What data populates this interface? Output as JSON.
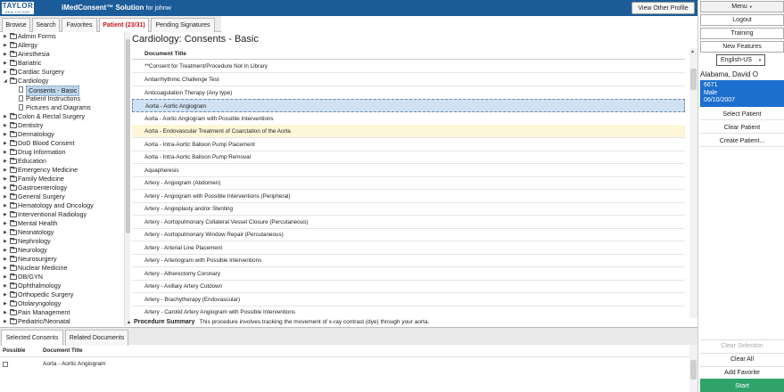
{
  "header": {
    "logo_line1": "TAYLOR",
    "logo_line2": "HEALTHCARE",
    "app_title": "iMedConsent™ Solution",
    "for_user": "for johnw",
    "view_other_profile": "View Other Profile"
  },
  "tabs": [
    {
      "label": "Browse"
    },
    {
      "label": "Search"
    },
    {
      "label": "Favorites"
    },
    {
      "label": "Patient (23/31)"
    },
    {
      "label": "Pending Signatures"
    }
  ],
  "tree": {
    "items": [
      {
        "label": "Admin Forms"
      },
      {
        "label": "Allergy"
      },
      {
        "label": "Anesthesia"
      },
      {
        "label": "Bariatric"
      },
      {
        "label": "Cardiac Surgery"
      },
      {
        "label": "Cardiology"
      },
      {
        "label": "Consents - Basic"
      },
      {
        "label": "Patient Instructions"
      },
      {
        "label": "Pictures and Diagrams"
      },
      {
        "label": "Colon & Rectal Surgery"
      },
      {
        "label": "Dentistry"
      },
      {
        "label": "Dermatology"
      },
      {
        "label": "DoD Blood Consent"
      },
      {
        "label": "Drug Information"
      },
      {
        "label": "Education"
      },
      {
        "label": "Emergency Medicine"
      },
      {
        "label": "Family Medicine"
      },
      {
        "label": "Gastroenterology"
      },
      {
        "label": "General Surgery"
      },
      {
        "label": "Hematology and Oncology"
      },
      {
        "label": "Interventional Radiology"
      },
      {
        "label": "Mental Health"
      },
      {
        "label": "Neonatology"
      },
      {
        "label": "Nephrology"
      },
      {
        "label": "Neurology"
      },
      {
        "label": "Neurosurgery"
      },
      {
        "label": "Nuclear Medicine"
      },
      {
        "label": "OB/GYN"
      },
      {
        "label": "Ophthalmology"
      },
      {
        "label": "Orthopedic Surgery"
      },
      {
        "label": "Otolaryngology"
      },
      {
        "label": "Pain Management"
      },
      {
        "label": "Pediatric/Neonatal"
      }
    ]
  },
  "main": {
    "title": "Cardiology: Consents - Basic",
    "column_header": "Document Title",
    "rows": [
      "**Consent for Treatment/Procedure Not In Library",
      "Antiarrhythmic Challenge Test",
      "Anticoagulation Therapy (Any type)",
      "Aorta - Aortic Angiogram",
      "Aorta - Aortic Angiogram with Possible Interventions",
      "Aorta - Endovascular Treatment of Coarctation of the Aorta",
      "Aorta - Intra-Aortic Balloon Pump Placement",
      "Aorta - Intra-Aortic Balloon Pump Removal",
      "Aquapheresis",
      "Artery - Angiogram (Abdomen)",
      "Artery - Angiogram with Possible Interventions (Peripheral)",
      "Artery - Angioplasty and/or Stenting",
      "Artery - Aortopulmonary Collateral Vessel Closure (Percutaneous)",
      "Artery - Aortopulmonary Window Repair (Percutaneous)",
      "Artery - Arterial Line Placement",
      "Artery - Arteriogram with Possible Interventions",
      "Artery - Atherectomy Coronary",
      "Artery - Axillary Artery Cutdown",
      "Artery - Brachytherapy (Endovascular)",
      "Artery - Carotid Artery Angiogram with Possible Interventions"
    ],
    "summary_label": "Procedure Summary",
    "summary_text": "This procedure involves tracking the movement of x-ray contrast (dye) through your aorta."
  },
  "bottom": {
    "tabs": [
      {
        "label": "Selected Consents"
      },
      {
        "label": "Related Documents"
      }
    ],
    "col_possible": "Possible",
    "col_title": "Document Title",
    "selected_item": "Aorta - Aortic Angiogram"
  },
  "sidebar": {
    "menu": "Menu",
    "logout": "Logout",
    "training": "Training",
    "new_features": "New Features",
    "language": "English-US",
    "patient_name": "Alabama, David O",
    "patient_id": "6671",
    "patient_sex": "Male",
    "patient_dob": "06/10/2007",
    "select_patient": "Select Patient",
    "clear_patient": "Clear Patient",
    "create_patient": "Create Patient...",
    "clear_selection": "Clear Selection",
    "clear_all": "Clear All",
    "add_favorite": "Add Favorite",
    "start": "Start"
  }
}
